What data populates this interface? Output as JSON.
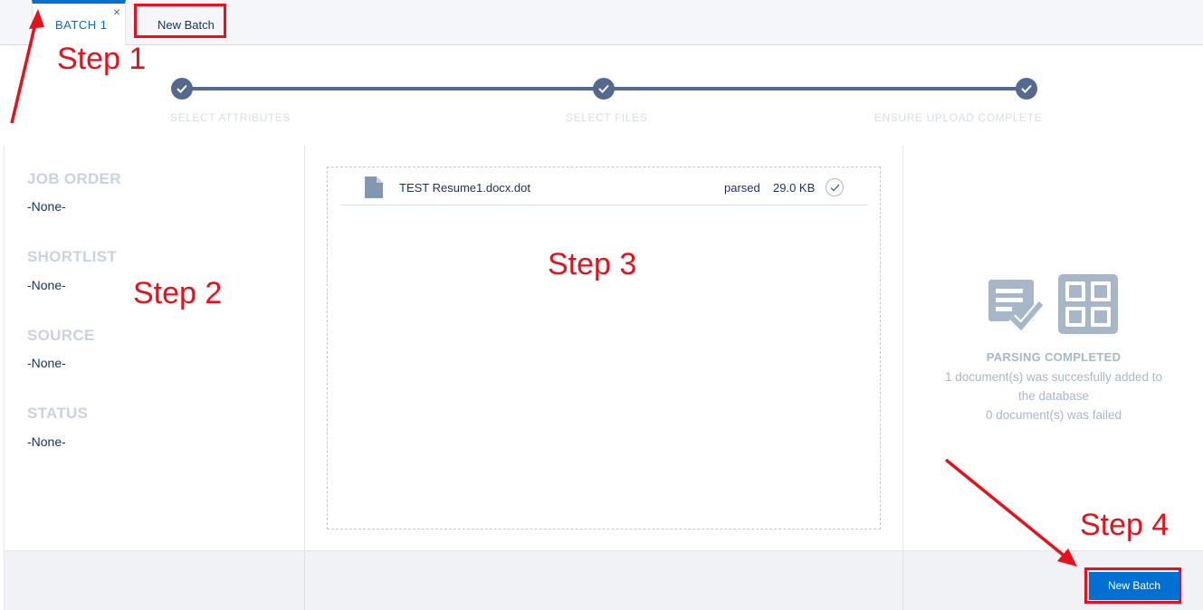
{
  "tabs": {
    "active_label": "BATCH 1",
    "close_glyph": "×",
    "new_label": "New Batch"
  },
  "steps": [
    {
      "label": "SELECT ATTRIBUTES",
      "completed": true
    },
    {
      "label": "SELECT FILES",
      "completed": true
    },
    {
      "label": "ENSURE UPLOAD COMPLETE",
      "completed": true
    }
  ],
  "fields": [
    {
      "heading": "JOB ORDER",
      "value": "-None-"
    },
    {
      "heading": "SHORTLIST",
      "value": "-None-"
    },
    {
      "heading": "SOURCE",
      "value": "-None-"
    },
    {
      "heading": "STATUS",
      "value": "-None-"
    }
  ],
  "files": [
    {
      "name": "TEST Resume1.docx.dot",
      "status": "parsed",
      "size": "29.0 KB",
      "icon": "document-icon"
    }
  ],
  "result": {
    "title": "PARSING COMPLETED",
    "line1": "1 document(s) was succesfully added to",
    "line2": "the database",
    "line3": "0 document(s) was failed"
  },
  "footer": {
    "new_batch_label": "New Batch"
  },
  "annotations": {
    "step1": "Step 1",
    "step2": "Step 2",
    "step3": "Step 3",
    "step4": "Step 4"
  },
  "colors": {
    "accent": "#0070d2",
    "stepper": "#54698d",
    "annotation": "#e8101a",
    "muted": "#a8b7c7"
  }
}
